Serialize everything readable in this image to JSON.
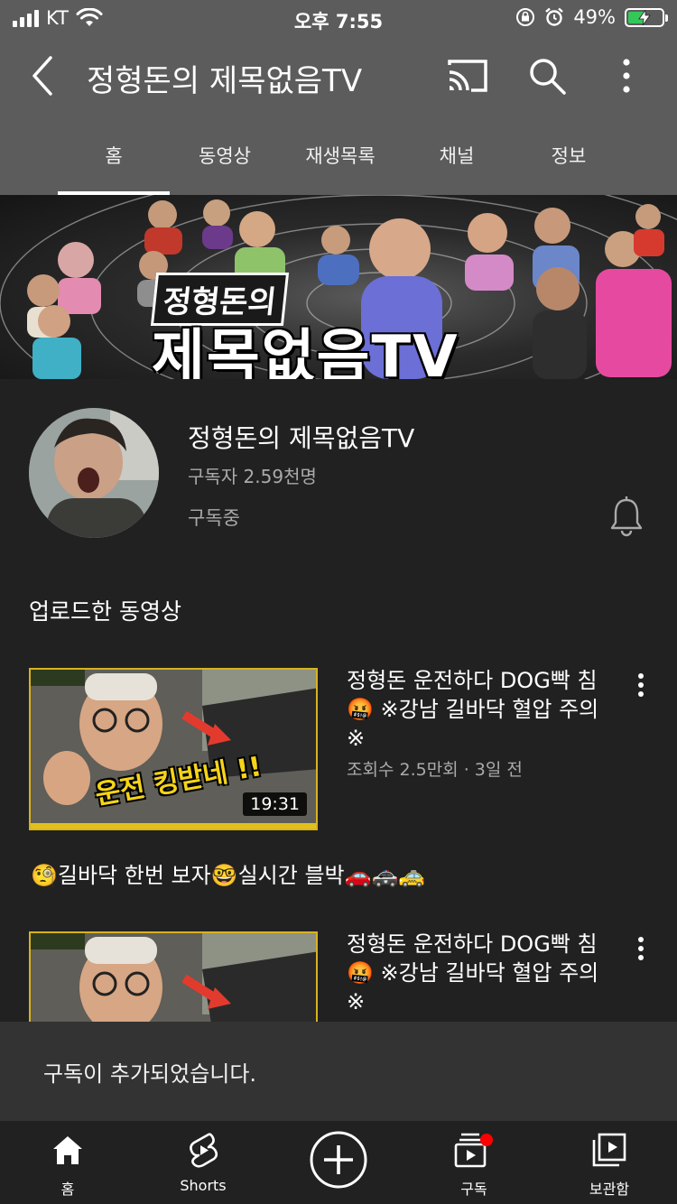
{
  "status_bar": {
    "carrier": "KT",
    "time": "오후 7:55",
    "battery": "49%",
    "battery_level": 0.49
  },
  "app_bar": {
    "title": "정형돈의 제목없음TV",
    "icons": [
      "back-icon",
      "cast-icon",
      "search-icon",
      "more-vert-icon"
    ]
  },
  "tabs": [
    {
      "label": "홈",
      "active": true
    },
    {
      "label": "동영상",
      "active": false
    },
    {
      "label": "재생목록",
      "active": false
    },
    {
      "label": "채널",
      "active": false
    },
    {
      "label": "정보",
      "active": false
    }
  ],
  "banner": {
    "line1": "정형돈의",
    "line2": "제목없음TV"
  },
  "channel": {
    "name": "정형돈의 제목없음TV",
    "subscribers": "구독자 2.59천명",
    "subscribed_label": "구독중"
  },
  "uploads": {
    "section_title": "업로드한 동영상",
    "videos": [
      {
        "title": "정형돈 운전하다 DOG빡 침🤬 ※강남 길바닥 혈압 주의※",
        "meta": "조회수 2.5만회 · 3일 전",
        "duration": "19:31",
        "thumb_text": "운전 킹받네 !!"
      },
      {
        "title": "정형돈 운전하다 DOG빡 침🤬 ※강남 길바닥 혈압 주의※",
        "meta": "",
        "duration": "",
        "thumb_text": ""
      }
    ],
    "description": "🧐길바닥 한번 보자🤓실시간 블박🚗🚓🚕"
  },
  "snackbar": {
    "message": "구독이 추가되었습니다."
  },
  "bottom_nav": [
    {
      "label": "홈",
      "icon": "home-icon"
    },
    {
      "label": "Shorts",
      "icon": "shorts-icon"
    },
    {
      "label": "",
      "icon": "create-icon"
    },
    {
      "label": "구독",
      "icon": "subscriptions-icon"
    },
    {
      "label": "보관함",
      "icon": "library-icon"
    }
  ],
  "colors": {
    "header_bg": "#5c5c5c",
    "page_bg": "#212121",
    "snackbar_bg": "#333333",
    "badge_red": "#ff0000",
    "battery_green": "#34c759"
  }
}
